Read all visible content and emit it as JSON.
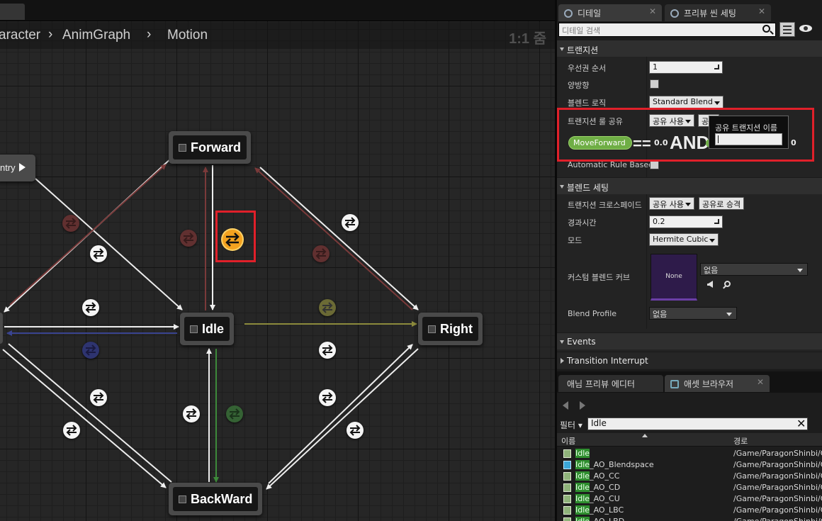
{
  "breadcrumb": [
    "aracter",
    "AnimGraph",
    "Motion"
  ],
  "zoom": "1:1 줌",
  "graph": {
    "entry_label": "ntry",
    "states": {
      "forward": "Forward",
      "idle": "Idle",
      "right": "Right",
      "backward": "BackWard"
    }
  },
  "tabs": {
    "details": "디테일",
    "preview_scene": "프리뷰 씬 세팅",
    "anim_preview": "애님 프리뷰 에디터",
    "asset_browser": "애셋 브라우저",
    "close_glyph": "✕"
  },
  "details": {
    "search_placeholder": "디테일 검색",
    "transition": {
      "header": "트랜지션",
      "priority_label": "우선권 순서",
      "priority_value": "1",
      "bidirectional_label": "양방향",
      "blend_logic_label": "블렌드 로직",
      "blend_logic_value": "Standard Blend",
      "share_rules_label": "트랜지션 룰 공유",
      "share_use": "공유 사용",
      "share_promote": "공유",
      "rule_pin": "MoveForward",
      "rule_eq": "==",
      "rule_val1": "0.0",
      "rule_and": "AND",
      "rule_val2": "0",
      "auto_rule_label": "Automatic Rule Based"
    },
    "share_popup": {
      "title": "공유 트랜지션 이름",
      "value": ""
    },
    "blend_settings": {
      "header": "블렌드 세팅",
      "crossfade_label": "트랜지션 크로스페이드",
      "crossfade_share": "공유 사용",
      "crossfade_promote": "공유로 승격",
      "duration_label": "경과시간",
      "duration_value": "0.2",
      "mode_label": "모드",
      "mode_value": "Hermite Cubic",
      "curve_label": "커스텀 블렌드 커브",
      "curve_thumb": "None",
      "curve_value": "없음",
      "profile_label": "Blend Profile",
      "profile_value": "없음"
    },
    "events_header": "Events",
    "transition_interrupt": "Transition Interrupt"
  },
  "asset_browser": {
    "filter_label": "필터",
    "search_value": "Idle",
    "clear_glyph": "✕",
    "col_name": "이름",
    "col_path": "경로",
    "rows": [
      {
        "name": "Idle",
        "path": "/Game/ParagonShinbi/Characters/",
        "icon": "anim"
      },
      {
        "name": "Idle_AO_Blendspace",
        "path": "/Game/ParagonShinbi/Characters/",
        "icon": "blendspace"
      },
      {
        "name": "Idle_AO_CC",
        "path": "/Game/ParagonShinbi/Characters/",
        "icon": "anim"
      },
      {
        "name": "Idle_AO_CD",
        "path": "/Game/ParagonShinbi/Characters/",
        "icon": "anim"
      },
      {
        "name": "Idle_AO_CU",
        "path": "/Game/ParagonShinbi/Characters/",
        "icon": "anim"
      },
      {
        "name": "Idle_AO_LBC",
        "path": "/Game/ParagonShinbi/Characters/",
        "icon": "anim"
      },
      {
        "name": "Idle_AO_LBD",
        "path": "/Game/ParagonShinbi/Characters/",
        "icon": "anim"
      }
    ]
  }
}
